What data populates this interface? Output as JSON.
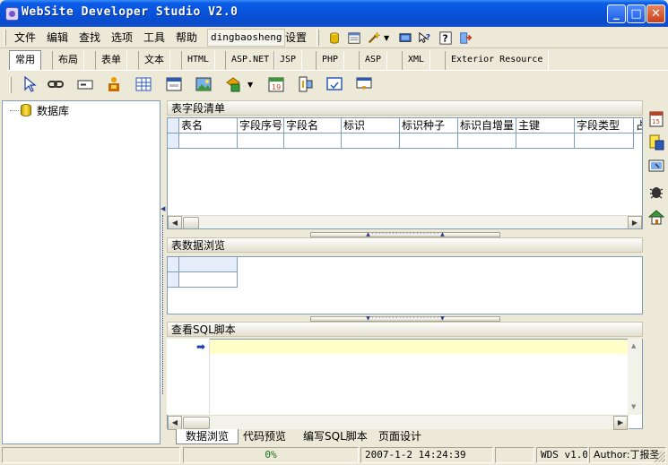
{
  "window": {
    "title": "WebSite Developer Studio V2.0"
  },
  "colors": {
    "titlebar": "#0a5ce8",
    "accent": "#3bbd3b",
    "selection": "#ffffc8"
  },
  "menu": {
    "items": [
      "文件",
      "编辑",
      "查找",
      "选项",
      "工具",
      "帮助"
    ],
    "user": "dingbaosheng",
    "settings": "设置"
  },
  "tabs": [
    "常用",
    "布局",
    "表单",
    "文本",
    "HTML",
    "ASP.NET",
    "JSP",
    "PHP",
    "ASP",
    "XML",
    "Exterior Resource"
  ],
  "active_tab": "常用",
  "tree": {
    "root": "数据库"
  },
  "fields_panel": {
    "title": "表字段清单",
    "columns": [
      "表名",
      "字段序号",
      "字段名",
      "标识",
      "标识种子",
      "标识自增量",
      "主键",
      "字段类型",
      "占"
    ]
  },
  "data_panel": {
    "title": "表数据浏览"
  },
  "sql_panel": {
    "title": "查看SQL脚本"
  },
  "bottom_tabs": [
    "数据浏览",
    "代码预览",
    "编写SQL脚本",
    "页面设计"
  ],
  "active_bottom_tab": "数据浏览",
  "status": {
    "progress_label": "0%",
    "progress": 0,
    "datetime": "2007-1-2 14:24:39",
    "version": "WDS v1.0",
    "author": "Author:丁报圣"
  },
  "icons": {
    "toolbar1": [
      "database-icon",
      "document-icon",
      "wand-icon",
      "monitor-icon",
      "help-pointer-icon",
      "help-icon",
      "exit-icon"
    ],
    "toolbar2": [
      "pointer-icon",
      "link-icon",
      "textbox-icon",
      "component-icon",
      "table-icon",
      "form-icon",
      "image-icon",
      "shapes-icon",
      "calendar-icon",
      "layout-icon",
      "window-icon",
      "save-form-icon"
    ],
    "right": [
      "calendar-icon",
      "server-icon",
      "monitor-icon",
      "bug-icon",
      "home-icon"
    ]
  }
}
